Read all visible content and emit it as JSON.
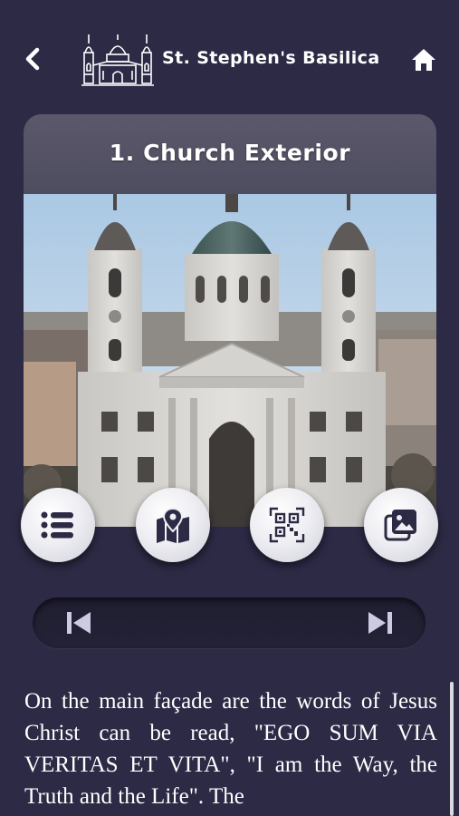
{
  "header": {
    "title": "St. Stephen's Basilica",
    "back_icon": "chevron-left-icon",
    "home_icon": "home-icon",
    "logo": "basilica-outline-logo"
  },
  "stop": {
    "title": "1. Church Exterior",
    "image": "basilica-facade-photo"
  },
  "actions": [
    {
      "name": "list",
      "icon": "list-icon"
    },
    {
      "name": "map",
      "icon": "map-pin-icon"
    },
    {
      "name": "qr",
      "icon": "qr-code-icon"
    },
    {
      "name": "gallery",
      "icon": "gallery-icon"
    }
  ],
  "player": {
    "prev_icon": "skip-previous-icon",
    "next_icon": "skip-next-icon"
  },
  "description": "On the main façade are the words of Jesus Christ can be read, \"EGO SUM VIA VERITAS ET VITA\", \"I am the Way, the Truth and the Life\". The",
  "colors": {
    "background": "#2c2a45",
    "card_header": "#55536a",
    "button_face": "#f2f2f6",
    "icon_dark": "#2c2a45",
    "player_bg": "#201e31",
    "player_icon": "#cdcbe4"
  }
}
